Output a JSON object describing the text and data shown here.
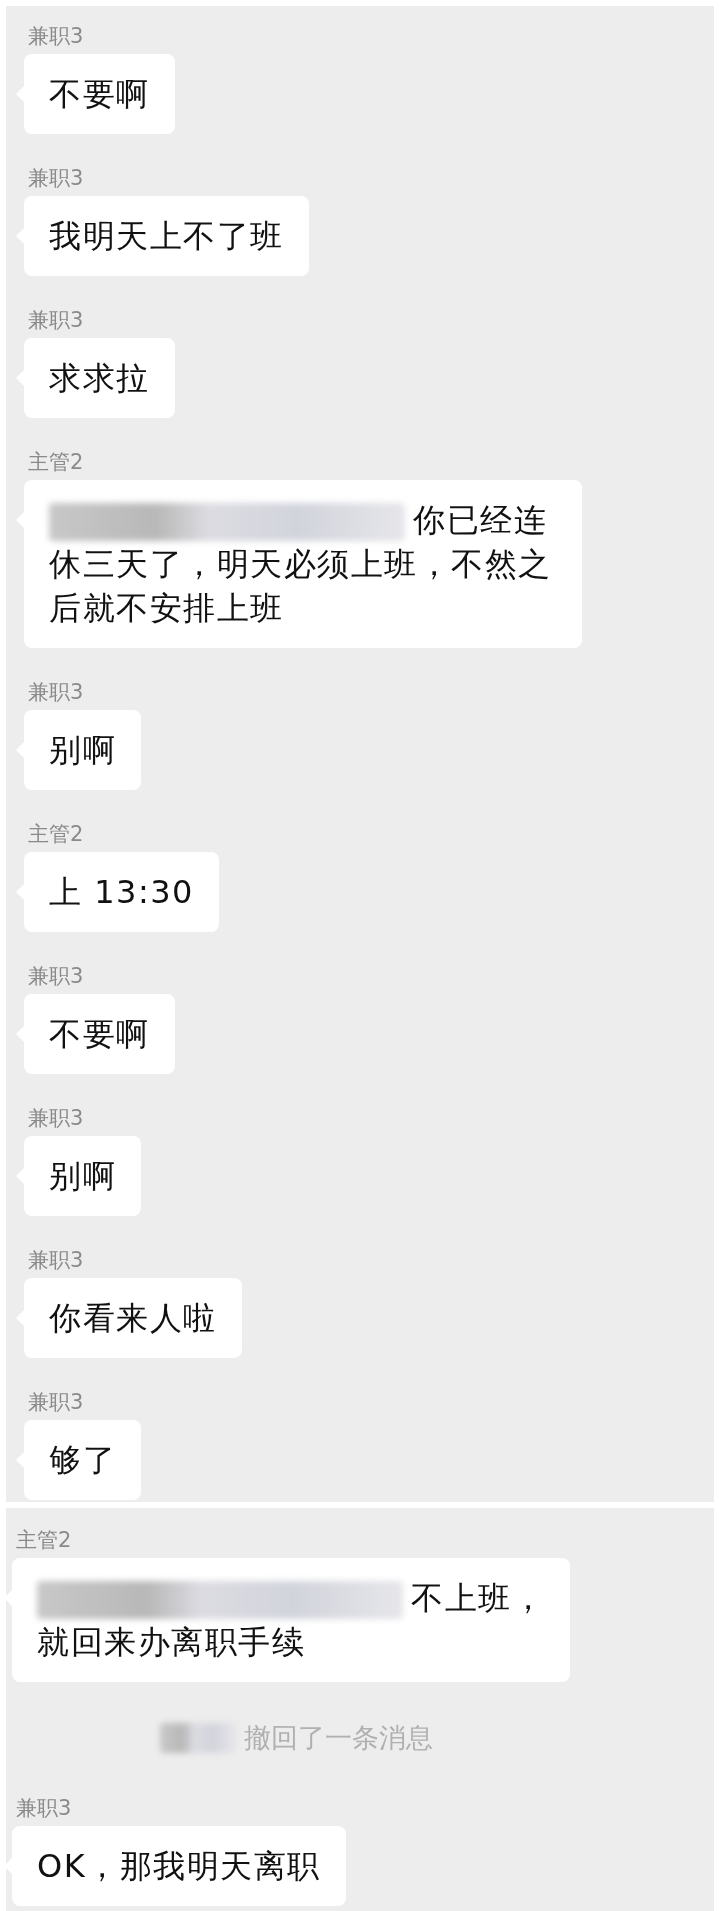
{
  "panels": [
    {
      "messages": [
        {
          "kind": "text",
          "sender": "兼职3",
          "redacted": false,
          "text": "不要啊"
        },
        {
          "kind": "text",
          "sender": "兼职3",
          "redacted": false,
          "text": "我明天上不了班"
        },
        {
          "kind": "text",
          "sender": "兼职3",
          "redacted": false,
          "text": "求求拉"
        },
        {
          "kind": "text",
          "sender": "主管2",
          "redacted": true,
          "text": "你已经连休三天了，明天必须上班，不然之后就不安排上班"
        },
        {
          "kind": "text",
          "sender": "兼职3",
          "redacted": false,
          "text": "别啊"
        },
        {
          "kind": "text",
          "sender": "主管2",
          "redacted": false,
          "text": "上 13:30"
        },
        {
          "kind": "text",
          "sender": "兼职3",
          "redacted": false,
          "text": "不要啊"
        },
        {
          "kind": "text",
          "sender": "兼职3",
          "redacted": false,
          "text": "别啊"
        },
        {
          "kind": "text",
          "sender": "兼职3",
          "redacted": false,
          "text": "你看来人啦"
        },
        {
          "kind": "text",
          "sender": "兼职3",
          "redacted": false,
          "text": "够了"
        }
      ]
    },
    {
      "messages": [
        {
          "kind": "text",
          "sender": "主管2",
          "redacted": true,
          "text": "不上班，就回来办离职手续"
        },
        {
          "kind": "recall",
          "redacted": true,
          "text": "撤回了一条消息"
        },
        {
          "kind": "text",
          "sender": "兼职3",
          "redacted": false,
          "text": "OK，那我明天离职"
        }
      ]
    }
  ]
}
